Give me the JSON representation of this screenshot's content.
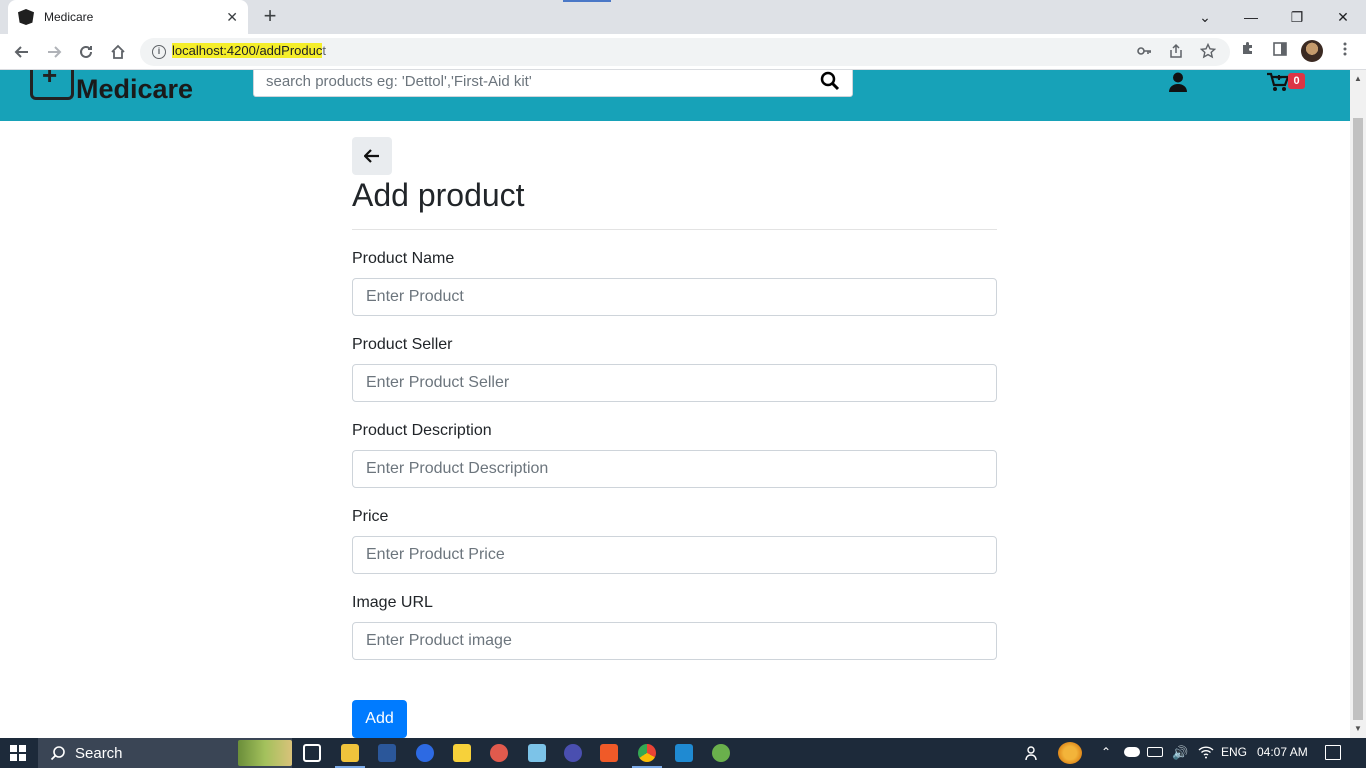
{
  "browser": {
    "tab_title": "Medicare",
    "tab_close": "✕",
    "new_tab": "+",
    "url_highlight": "localhost:4200/addProduc",
    "url_rest": "t",
    "controls": {
      "minimize": "—",
      "restore": "❐",
      "close": "✕",
      "tab_search": "⌄"
    }
  },
  "navbar": {
    "brand": "Medicare",
    "search_placeholder": "search products eg: 'Dettol','First-Aid kit'",
    "cart_count": "0",
    "accent_color": "#17a2b8"
  },
  "form": {
    "title": "Add product",
    "fields": [
      {
        "label": "Product Name",
        "placeholder": "Enter Product"
      },
      {
        "label": "Product Seller",
        "placeholder": "Enter Product Seller"
      },
      {
        "label": "Product Description",
        "placeholder": "Enter Product Description"
      },
      {
        "label": "Price",
        "placeholder": "Enter Product Price"
      },
      {
        "label": "Image URL",
        "placeholder": "Enter Product image"
      }
    ],
    "submit_label": "Add",
    "submit_color": "#007bff"
  },
  "taskbar": {
    "search_label": "Search",
    "language": "ENG",
    "time": "04:07 AM"
  }
}
